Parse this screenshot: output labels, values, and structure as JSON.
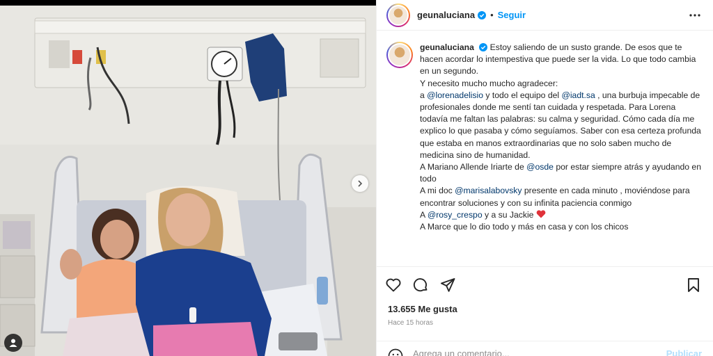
{
  "post": {
    "username": "geunaluciana",
    "dot": "•",
    "follow_label": "Seguir",
    "caption_lines": [
      "Estoy saliendo de un susto grande. De esos que te hacen acordar lo intempestiva que puede ser la vida. Lo que todo cambia en un segundo.",
      "Y necesito mucho mucho agradecer:"
    ],
    "thanks_1": {
      "prefix": "a ",
      "mention_1": "@lorenadelisio",
      "middle": " y todo el equipo del ",
      "mention_2": "@iadt.sa",
      "suffix": " , una burbuja impecable de profesionales donde me sentí tan cuidada y respetada. Para Lorena todavía me faltan las palabras: su calma y seguridad. Cómo cada día me explico lo que pasaba y cómo seguíamos. Saber con esa certeza profunda que estaba en manos extraordinarias que no solo saben mucho de medicina sino de humanidad."
    },
    "thanks_2": {
      "prefix": "A Mariano Allende Iriarte de ",
      "mention": "@osde",
      "suffix": " por estar siempre atrás y ayudando en todo"
    },
    "thanks_3": {
      "prefix": "A mi doc ",
      "mention": "@marisalabovsky",
      "suffix": " presente en cada minuto , moviéndose para encontrar soluciones y con su infinita paciencia conmigo"
    },
    "thanks_4": {
      "prefix": "A ",
      "mention": "@rosy_crespo",
      "suffix": " y a su Jackie "
    },
    "thanks_5": "A Marce que lo dio todo y más en casa y con los chicos",
    "likes": "13.655 Me gusta",
    "time": "Hace 15 horas",
    "comment_placeholder": "Agrega un comentario...",
    "publish_label": "Publicar"
  },
  "icons": {
    "verified": "verified-badge-icon",
    "more": "more-options-icon",
    "like": "heart-outline-icon",
    "comment": "comment-icon",
    "share": "share-icon",
    "save": "bookmark-icon",
    "next": "chevron-right-icon",
    "tag": "user-tag-icon",
    "emoji": "emoji-icon"
  },
  "colors": {
    "link": "#0095f6",
    "mention": "#00376b",
    "heart": "#ed4956",
    "muted": "#8e8e8e"
  }
}
